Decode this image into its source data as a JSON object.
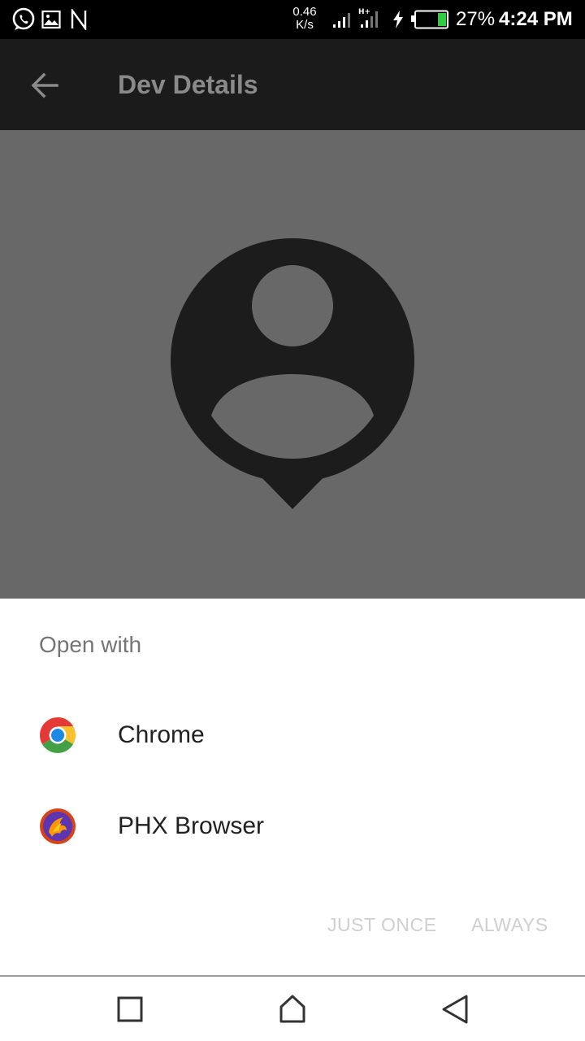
{
  "status_bar": {
    "net_speed_value": "0.46",
    "net_speed_unit": "K/s",
    "battery_percent": "27%",
    "time": "4:24 PM",
    "icons": [
      "whatsapp-icon",
      "image-icon",
      "n-icon",
      "signal-icon",
      "signal-ht-icon",
      "charging-icon",
      "battery-icon"
    ],
    "battery_level": 0.27
  },
  "app_bar": {
    "title": "Dev Details",
    "back_icon": "arrow-back-icon"
  },
  "content": {
    "image_icon": "person-pin-icon"
  },
  "chooser": {
    "title": "Open with",
    "apps": [
      {
        "label": "Chrome",
        "icon": "chrome-icon"
      },
      {
        "label": "PHX Browser",
        "icon": "phx-browser-icon"
      }
    ],
    "just_once_label": "JUST ONCE",
    "always_label": "ALWAYS"
  },
  "nav_bar": {
    "items": [
      "recents-icon",
      "home-icon",
      "back-icon"
    ]
  },
  "colors": {
    "status_bar_bg": "#000000",
    "app_bar_dimmed_bg": "#1b1b1b",
    "content_dimmed_bg": "#686868",
    "sheet_bg": "#ffffff",
    "disabled_button_text": "#cfcfcf"
  }
}
